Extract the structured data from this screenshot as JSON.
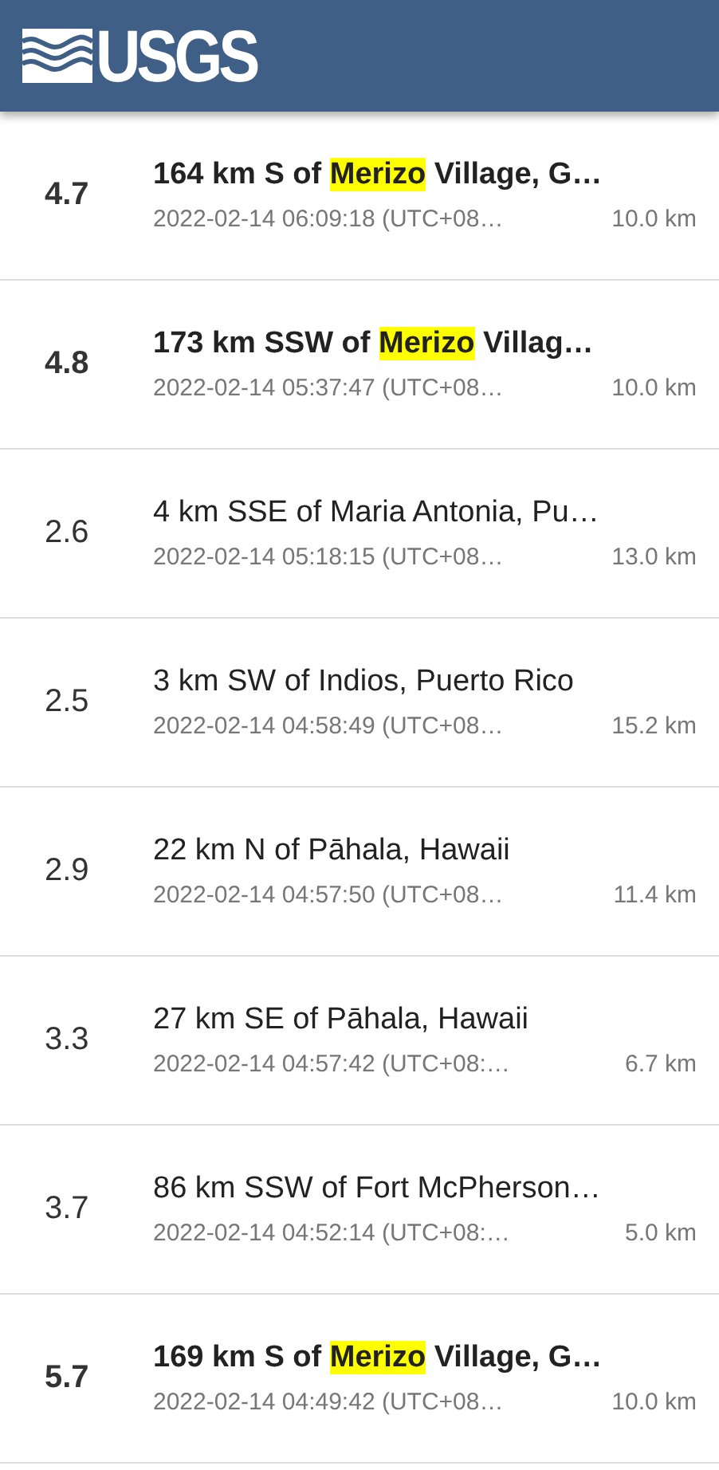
{
  "header": {
    "logo": "USGS"
  },
  "events": [
    {
      "magnitude": "4.7",
      "important": true,
      "title_parts": [
        {
          "text": "164 km S of ",
          "highlighted": false
        },
        {
          "text": "Merizo",
          "highlighted": true
        },
        {
          "text": " Village, G…",
          "highlighted": false
        }
      ],
      "time": "2022-02-14 06:09:18 (UTC+08…",
      "depth": "10.0 km"
    },
    {
      "magnitude": "4.8",
      "important": true,
      "title_parts": [
        {
          "text": "173 km SSW of ",
          "highlighted": false
        },
        {
          "text": "Merizo",
          "highlighted": true
        },
        {
          "text": " Villag…",
          "highlighted": false
        }
      ],
      "time": "2022-02-14 05:37:47 (UTC+08…",
      "depth": "10.0 km"
    },
    {
      "magnitude": "2.6",
      "important": false,
      "title_parts": [
        {
          "text": "4 km SSE of Maria Antonia, Pu…",
          "highlighted": false
        }
      ],
      "time": "2022-02-14 05:18:15 (UTC+08…",
      "depth": "13.0 km"
    },
    {
      "magnitude": "2.5",
      "important": false,
      "title_parts": [
        {
          "text": "3 km SW of Indios, Puerto Rico",
          "highlighted": false
        }
      ],
      "time": "2022-02-14 04:58:49 (UTC+08…",
      "depth": "15.2 km"
    },
    {
      "magnitude": "2.9",
      "important": false,
      "title_parts": [
        {
          "text": "22 km N of Pāhala, Hawaii",
          "highlighted": false
        }
      ],
      "time": "2022-02-14 04:57:50 (UTC+08…",
      "depth": "11.4 km"
    },
    {
      "magnitude": "3.3",
      "important": false,
      "title_parts": [
        {
          "text": "27 km SE of Pāhala, Hawaii",
          "highlighted": false
        }
      ],
      "time": "2022-02-14 04:57:42 (UTC+08:…",
      "depth": "6.7 km"
    },
    {
      "magnitude": "3.7",
      "important": false,
      "title_parts": [
        {
          "text": "86 km SSW of Fort McPherson…",
          "highlighted": false
        }
      ],
      "time": "2022-02-14 04:52:14 (UTC+08:…",
      "depth": "5.0 km"
    },
    {
      "magnitude": "5.7",
      "important": true,
      "title_parts": [
        {
          "text": "169 km S of ",
          "highlighted": false
        },
        {
          "text": "Merizo",
          "highlighted": true
        },
        {
          "text": " Village, G…",
          "highlighted": false
        }
      ],
      "time": "2022-02-14 04:49:42 (UTC+08…",
      "depth": "10.0 km"
    }
  ]
}
